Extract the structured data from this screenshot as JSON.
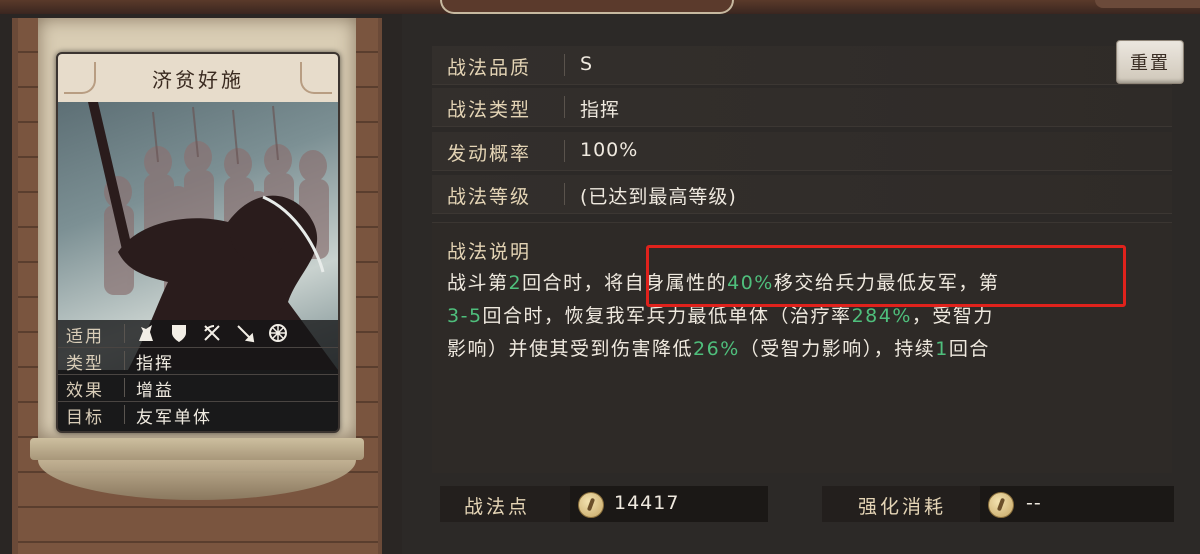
{
  "card": {
    "title": "济贫好施",
    "rows": [
      {
        "key": "适用",
        "icons": [
          "cavalry-icon",
          "shield-icon",
          "crossbow-icon",
          "spear-icon",
          "wheel-icon"
        ]
      },
      {
        "key": "类型",
        "value": "指挥"
      },
      {
        "key": "效果",
        "value": "增益"
      },
      {
        "key": "目标",
        "value": "友军单体"
      }
    ]
  },
  "fields": {
    "quality_label": "战法品质",
    "quality_value": "S",
    "type_label": "战法类型",
    "type_value": "指挥",
    "rate_label": "发动概率",
    "rate_value": "100%",
    "level_label": "战法等级",
    "level_value": "(已达到最高等级)"
  },
  "reset_label": "重置",
  "description": {
    "title": "战法说明",
    "line1_a": "战斗第",
    "line1_b": "2",
    "line1_c": "回合时，将自身属性的",
    "line1_d": "40%",
    "line1_e": "移交给兵力最低友军，第",
    "line2_a": "3-5",
    "line2_b": "回合时，恢复我军兵力最低单体（治疗率",
    "line2_c": "284%",
    "line2_d": "，受智力",
    "line3_a": "影响）并使其受到伤害降低",
    "line3_b": "26%",
    "line3_c": "（受智力影响），持续",
    "line3_d": "1",
    "line3_e": "回合"
  },
  "bottom": {
    "points_label": "战法点",
    "points_value": "14417",
    "cost_label": "强化消耗",
    "cost_value": "--"
  },
  "colors": {
    "highlight_value": "#4fbf7c",
    "annotation_box": "#e0221c"
  }
}
